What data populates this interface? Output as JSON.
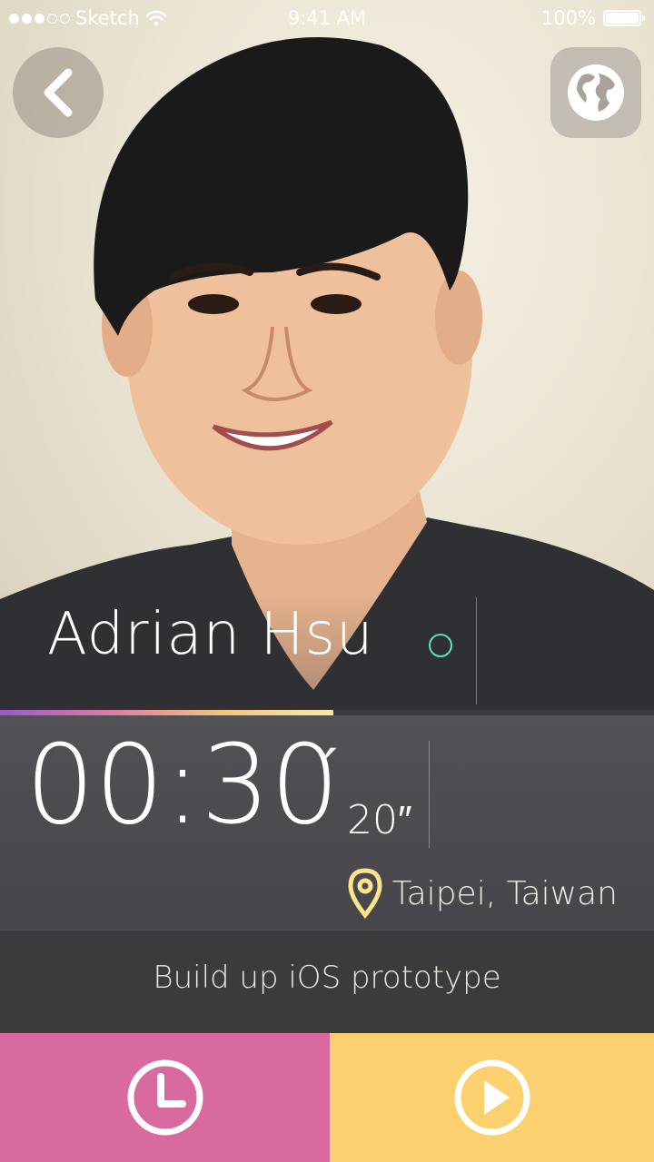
{
  "status_bar": {
    "carrier": "Sketch",
    "time": "9:41 AM",
    "battery": "100%"
  },
  "profile": {
    "name": "Adrian Hsu",
    "status_color": "#5fe0c0",
    "photo_description_icon": "profile-photo"
  },
  "progress": {
    "fraction": 0.51,
    "colors": [
      "#9b59c9",
      "#e07aa5",
      "#f3c47a",
      "#fbe9a8"
    ]
  },
  "timer": {
    "minutes_display": "00:30",
    "minute_mark": "′",
    "seconds": "20″"
  },
  "location": {
    "label": "Taipei, Taiwan",
    "icon": "location-pin-icon",
    "icon_color": "#fbe58a"
  },
  "task": {
    "label": "Build up iOS prototype"
  },
  "actions": {
    "clock_icon": "clock-icon",
    "play_icon": "play-icon",
    "clock_color": "#d96aa0",
    "play_color": "#fbd06f"
  }
}
